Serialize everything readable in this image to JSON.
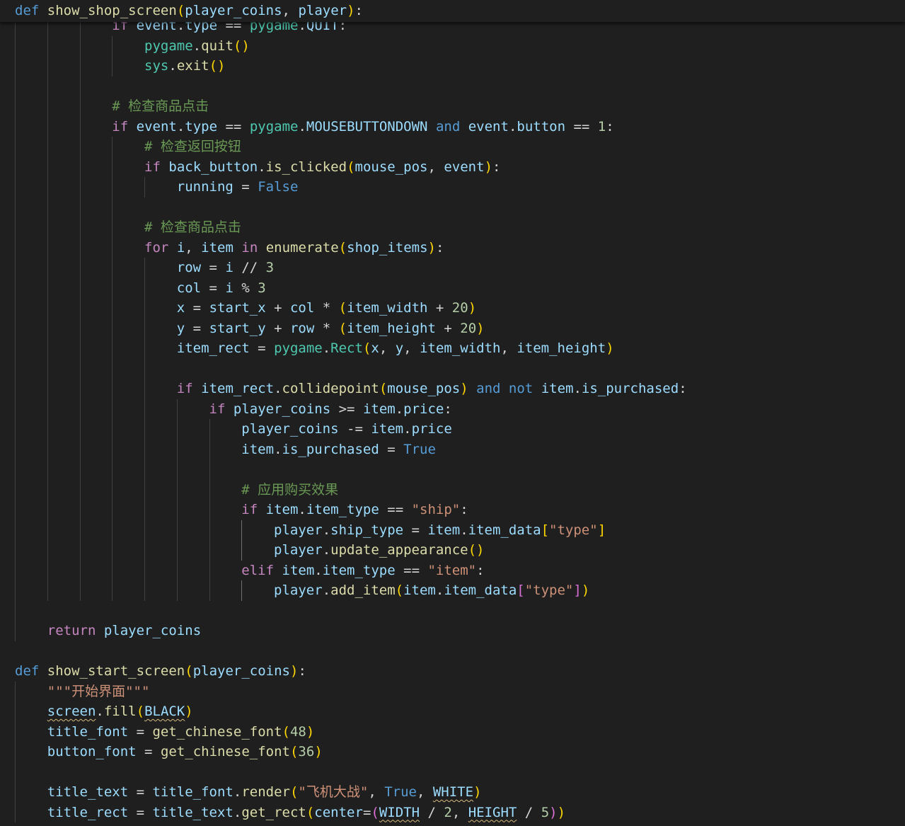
{
  "editor": {
    "sticky_line": [
      [
        "kw",
        "def"
      ],
      [
        "op",
        " "
      ],
      [
        "fn",
        "show_shop_screen"
      ],
      [
        "b1",
        "("
      ],
      [
        "var",
        "player_coins"
      ],
      [
        "op",
        ", "
      ],
      [
        "var",
        "player"
      ],
      [
        "b1",
        ")"
      ],
      [
        "op",
        ":"
      ]
    ],
    "lines": [
      [
        [
          "op",
          "            "
        ],
        [
          "ctl",
          "if"
        ],
        [
          "op",
          " "
        ],
        [
          "var",
          "event"
        ],
        [
          "op",
          "."
        ],
        [
          "var",
          "type"
        ],
        [
          "op",
          " == "
        ],
        [
          "cls",
          "pygame"
        ],
        [
          "op",
          "."
        ],
        [
          "var",
          "QUIT"
        ],
        [
          "op",
          ":"
        ]
      ],
      [
        [
          "op",
          "                "
        ],
        [
          "cls",
          "pygame"
        ],
        [
          "op",
          "."
        ],
        [
          "fn",
          "quit"
        ],
        [
          "b1",
          "()"
        ]
      ],
      [
        [
          "op",
          "                "
        ],
        [
          "cls",
          "sys"
        ],
        [
          "op",
          "."
        ],
        [
          "fn",
          "exit"
        ],
        [
          "b1",
          "()"
        ]
      ],
      [],
      [
        [
          "op",
          "            "
        ],
        [
          "cm",
          "# 检查商品点击"
        ]
      ],
      [
        [
          "op",
          "            "
        ],
        [
          "ctl",
          "if"
        ],
        [
          "op",
          " "
        ],
        [
          "var",
          "event"
        ],
        [
          "op",
          "."
        ],
        [
          "var",
          "type"
        ],
        [
          "op",
          " == "
        ],
        [
          "cls",
          "pygame"
        ],
        [
          "op",
          "."
        ],
        [
          "var",
          "MOUSEBUTTONDOWN"
        ],
        [
          "op",
          " "
        ],
        [
          "kw",
          "and"
        ],
        [
          "op",
          " "
        ],
        [
          "var",
          "event"
        ],
        [
          "op",
          "."
        ],
        [
          "var",
          "button"
        ],
        [
          "op",
          " == "
        ],
        [
          "num",
          "1"
        ],
        [
          "op",
          ":"
        ]
      ],
      [
        [
          "op",
          "                "
        ],
        [
          "cm",
          "# 检查返回按钮"
        ]
      ],
      [
        [
          "op",
          "                "
        ],
        [
          "ctl",
          "if"
        ],
        [
          "op",
          " "
        ],
        [
          "var",
          "back_button"
        ],
        [
          "op",
          "."
        ],
        [
          "fn",
          "is_clicked"
        ],
        [
          "b1",
          "("
        ],
        [
          "var",
          "mouse_pos"
        ],
        [
          "op",
          ", "
        ],
        [
          "var",
          "event"
        ],
        [
          "b1",
          ")"
        ],
        [
          "op",
          ":"
        ]
      ],
      [
        [
          "op",
          "                    "
        ],
        [
          "var",
          "running"
        ],
        [
          "op",
          " = "
        ],
        [
          "kw",
          "False"
        ]
      ],
      [],
      [
        [
          "op",
          "                "
        ],
        [
          "cm",
          "# 检查商品点击"
        ]
      ],
      [
        [
          "op",
          "                "
        ],
        [
          "ctl",
          "for"
        ],
        [
          "op",
          " "
        ],
        [
          "var",
          "i"
        ],
        [
          "op",
          ", "
        ],
        [
          "var",
          "item"
        ],
        [
          "op",
          " "
        ],
        [
          "ctl",
          "in"
        ],
        [
          "op",
          " "
        ],
        [
          "fn",
          "enumerate"
        ],
        [
          "b1",
          "("
        ],
        [
          "var",
          "shop_items"
        ],
        [
          "b1",
          ")"
        ],
        [
          "op",
          ":"
        ]
      ],
      [
        [
          "op",
          "                    "
        ],
        [
          "var",
          "row"
        ],
        [
          "op",
          " = "
        ],
        [
          "var",
          "i"
        ],
        [
          "op",
          " // "
        ],
        [
          "num",
          "3"
        ]
      ],
      [
        [
          "op",
          "                    "
        ],
        [
          "var",
          "col"
        ],
        [
          "op",
          " = "
        ],
        [
          "var",
          "i"
        ],
        [
          "op",
          " % "
        ],
        [
          "num",
          "3"
        ]
      ],
      [
        [
          "op",
          "                    "
        ],
        [
          "var",
          "x"
        ],
        [
          "op",
          " = "
        ],
        [
          "var",
          "start_x"
        ],
        [
          "op",
          " + "
        ],
        [
          "var",
          "col"
        ],
        [
          "op",
          " * "
        ],
        [
          "b1",
          "("
        ],
        [
          "var",
          "item_width"
        ],
        [
          "op",
          " + "
        ],
        [
          "num",
          "20"
        ],
        [
          "b1",
          ")"
        ]
      ],
      [
        [
          "op",
          "                    "
        ],
        [
          "var",
          "y"
        ],
        [
          "op",
          " = "
        ],
        [
          "var",
          "start_y"
        ],
        [
          "op",
          " + "
        ],
        [
          "var",
          "row"
        ],
        [
          "op",
          " * "
        ],
        [
          "b1",
          "("
        ],
        [
          "var",
          "item_height"
        ],
        [
          "op",
          " + "
        ],
        [
          "num",
          "20"
        ],
        [
          "b1",
          ")"
        ]
      ],
      [
        [
          "op",
          "                    "
        ],
        [
          "var",
          "item_rect"
        ],
        [
          "op",
          " = "
        ],
        [
          "cls",
          "pygame"
        ],
        [
          "op",
          "."
        ],
        [
          "cls",
          "Rect"
        ],
        [
          "b1",
          "("
        ],
        [
          "var",
          "x"
        ],
        [
          "op",
          ", "
        ],
        [
          "var",
          "y"
        ],
        [
          "op",
          ", "
        ],
        [
          "var",
          "item_width"
        ],
        [
          "op",
          ", "
        ],
        [
          "var",
          "item_height"
        ],
        [
          "b1",
          ")"
        ]
      ],
      [],
      [
        [
          "op",
          "                    "
        ],
        [
          "ctl",
          "if"
        ],
        [
          "op",
          " "
        ],
        [
          "var",
          "item_rect"
        ],
        [
          "op",
          "."
        ],
        [
          "fn",
          "collidepoint"
        ],
        [
          "b1",
          "("
        ],
        [
          "var",
          "mouse_pos"
        ],
        [
          "b1",
          ")"
        ],
        [
          "op",
          " "
        ],
        [
          "kw",
          "and"
        ],
        [
          "op",
          " "
        ],
        [
          "kw",
          "not"
        ],
        [
          "op",
          " "
        ],
        [
          "var",
          "item"
        ],
        [
          "op",
          "."
        ],
        [
          "var",
          "is_purchased"
        ],
        [
          "op",
          ":"
        ]
      ],
      [
        [
          "op",
          "                        "
        ],
        [
          "ctl",
          "if"
        ],
        [
          "op",
          " "
        ],
        [
          "var",
          "player_coins"
        ],
        [
          "op",
          " >= "
        ],
        [
          "var",
          "item"
        ],
        [
          "op",
          "."
        ],
        [
          "var",
          "price"
        ],
        [
          "op",
          ":"
        ]
      ],
      [
        [
          "op",
          "                            "
        ],
        [
          "var",
          "player_coins"
        ],
        [
          "op",
          " -= "
        ],
        [
          "var",
          "item"
        ],
        [
          "op",
          "."
        ],
        [
          "var",
          "price"
        ]
      ],
      [
        [
          "op",
          "                            "
        ],
        [
          "var",
          "item"
        ],
        [
          "op",
          "."
        ],
        [
          "var",
          "is_purchased"
        ],
        [
          "op",
          " = "
        ],
        [
          "kw",
          "True"
        ]
      ],
      [],
      [
        [
          "op",
          "                            "
        ],
        [
          "cm",
          "# 应用购买效果"
        ]
      ],
      [
        [
          "op",
          "                            "
        ],
        [
          "ctl",
          "if"
        ],
        [
          "op",
          " "
        ],
        [
          "var",
          "item"
        ],
        [
          "op",
          "."
        ],
        [
          "var",
          "item_type"
        ],
        [
          "op",
          " == "
        ],
        [
          "str",
          "\"ship\""
        ],
        [
          "op",
          ":"
        ]
      ],
      [
        [
          "op",
          "                                "
        ],
        [
          "var",
          "player"
        ],
        [
          "op",
          "."
        ],
        [
          "var",
          "ship_type"
        ],
        [
          "op",
          " = "
        ],
        [
          "var",
          "item"
        ],
        [
          "op",
          "."
        ],
        [
          "var",
          "item_data"
        ],
        [
          "b1",
          "["
        ],
        [
          "str",
          "\"type\""
        ],
        [
          "b1",
          "]"
        ]
      ],
      [
        [
          "op",
          "                                "
        ],
        [
          "var",
          "player"
        ],
        [
          "op",
          "."
        ],
        [
          "fn",
          "update_appearance"
        ],
        [
          "b1",
          "()"
        ]
      ],
      [
        [
          "op",
          "                            "
        ],
        [
          "ctl",
          "elif"
        ],
        [
          "op",
          " "
        ],
        [
          "var",
          "item"
        ],
        [
          "op",
          "."
        ],
        [
          "var",
          "item_type"
        ],
        [
          "op",
          " == "
        ],
        [
          "str",
          "\"item\""
        ],
        [
          "op",
          ":"
        ]
      ],
      [
        [
          "op",
          "                                "
        ],
        [
          "var",
          "player"
        ],
        [
          "op",
          "."
        ],
        [
          "fn",
          "add_item"
        ],
        [
          "b1",
          "("
        ],
        [
          "var",
          "item"
        ],
        [
          "op",
          "."
        ],
        [
          "var",
          "item_data"
        ],
        [
          "b2",
          "["
        ],
        [
          "str",
          "\"type\""
        ],
        [
          "b2",
          "]"
        ],
        [
          "b1",
          ")"
        ]
      ],
      [],
      [
        [
          "op",
          "    "
        ],
        [
          "ctl",
          "return"
        ],
        [
          "op",
          " "
        ],
        [
          "var",
          "player_coins"
        ]
      ],
      [],
      [
        [
          "kw",
          "def"
        ],
        [
          "op",
          " "
        ],
        [
          "fn",
          "show_start_screen"
        ],
        [
          "b1",
          "("
        ],
        [
          "var",
          "player_coins"
        ],
        [
          "b1",
          ")"
        ],
        [
          "op",
          ":"
        ]
      ],
      [
        [
          "op",
          "    "
        ],
        [
          "str",
          "\"\"\"开始界面\"\"\""
        ]
      ],
      [
        [
          "op",
          "    "
        ],
        [
          "var warn",
          "screen"
        ],
        [
          "op",
          "."
        ],
        [
          "fn",
          "fill"
        ],
        [
          "b1",
          "("
        ],
        [
          "var warn",
          "BLACK"
        ],
        [
          "b1",
          ")"
        ]
      ],
      [
        [
          "op",
          "    "
        ],
        [
          "var",
          "title_font"
        ],
        [
          "op",
          " = "
        ],
        [
          "fn",
          "get_chinese_font"
        ],
        [
          "b1",
          "("
        ],
        [
          "num",
          "48"
        ],
        [
          "b1",
          ")"
        ]
      ],
      [
        [
          "op",
          "    "
        ],
        [
          "var",
          "button_font"
        ],
        [
          "op",
          " = "
        ],
        [
          "fn",
          "get_chinese_font"
        ],
        [
          "b1",
          "("
        ],
        [
          "num",
          "36"
        ],
        [
          "b1",
          ")"
        ]
      ],
      [],
      [
        [
          "op",
          "    "
        ],
        [
          "var",
          "title_text"
        ],
        [
          "op",
          " = "
        ],
        [
          "var",
          "title_font"
        ],
        [
          "op",
          "."
        ],
        [
          "fn",
          "render"
        ],
        [
          "b1",
          "("
        ],
        [
          "str",
          "\"飞机大战\""
        ],
        [
          "op",
          ", "
        ],
        [
          "kw",
          "True"
        ],
        [
          "op",
          ", "
        ],
        [
          "var warn",
          "WHITE"
        ],
        [
          "b1",
          ")"
        ]
      ],
      [
        [
          "op",
          "    "
        ],
        [
          "var",
          "title_rect"
        ],
        [
          "op",
          " = "
        ],
        [
          "var",
          "title_text"
        ],
        [
          "op",
          "."
        ],
        [
          "fn",
          "get_rect"
        ],
        [
          "b1",
          "("
        ],
        [
          "var",
          "center"
        ],
        [
          "op",
          "="
        ],
        [
          "b2",
          "("
        ],
        [
          "var warn",
          "WIDTH"
        ],
        [
          "op",
          " / "
        ],
        [
          "num",
          "2"
        ],
        [
          "op",
          ", "
        ],
        [
          "var warn",
          "HEIGHT"
        ],
        [
          "op",
          " / "
        ],
        [
          "num",
          "5"
        ],
        [
          "b2",
          ")"
        ],
        [
          "b1",
          ")"
        ]
      ]
    ]
  }
}
